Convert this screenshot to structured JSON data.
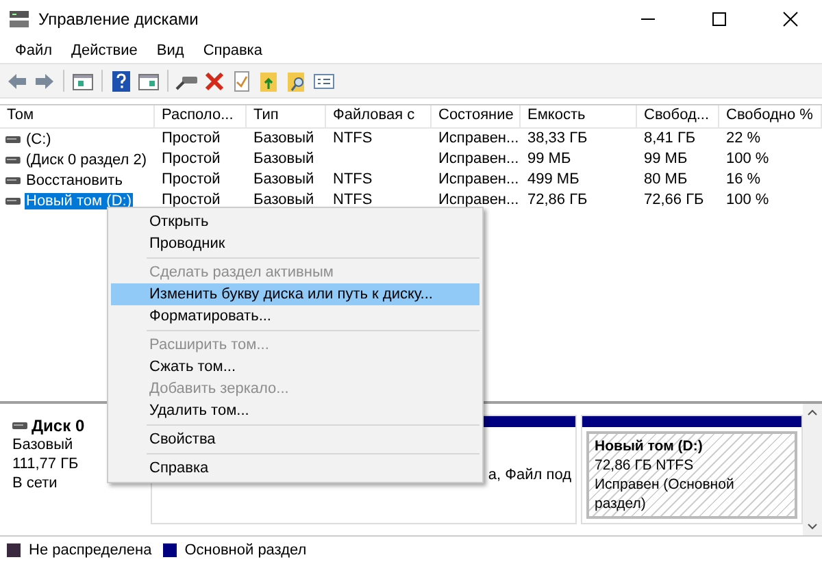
{
  "window": {
    "title": "Управление дисками"
  },
  "menu_bar": [
    "Файл",
    "Действие",
    "Вид",
    "Справка"
  ],
  "table": {
    "columns": [
      "Том",
      "Располо...",
      "Тип",
      "Файловая с",
      "Состояние",
      "Емкость",
      "Свобод...",
      "Свободно %"
    ],
    "rows": [
      {
        "selected": false,
        "cells": [
          "(C:)",
          "Простой",
          "Базовый",
          "NTFS",
          "Исправен...",
          "38,33 ГБ",
          "8,41 ГБ",
          "22 %"
        ]
      },
      {
        "selected": false,
        "cells": [
          "(Диск 0 раздел 2)",
          "Простой",
          "Базовый",
          "",
          "Исправен...",
          "99 МБ",
          "99 МБ",
          "100 %"
        ]
      },
      {
        "selected": false,
        "cells": [
          "Восстановить",
          "Простой",
          "Базовый",
          "NTFS",
          "Исправен...",
          "499 МБ",
          "80 МБ",
          "16 %"
        ]
      },
      {
        "selected": true,
        "cells": [
          "Новый том (D:)",
          "Простой",
          "Базовый",
          "NTFS",
          "Исправен...",
          "72,86 ГБ",
          "72,66 ГБ",
          "100 %"
        ]
      }
    ]
  },
  "context_menu": {
    "groups": [
      [
        {
          "label": "Открыть",
          "disabled": false,
          "selected": false
        },
        {
          "label": "Проводник",
          "disabled": false,
          "selected": false
        }
      ],
      [
        {
          "label": "Сделать раздел активным",
          "disabled": true,
          "selected": false
        },
        {
          "label": "Изменить букву диска или путь к диску...",
          "disabled": false,
          "selected": true
        },
        {
          "label": "Форматировать...",
          "disabled": false,
          "selected": false
        }
      ],
      [
        {
          "label": "Расширить том...",
          "disabled": true,
          "selected": false
        },
        {
          "label": "Сжать том...",
          "disabled": false,
          "selected": false
        },
        {
          "label": "Добавить зеркало...",
          "disabled": true,
          "selected": false
        },
        {
          "label": "Удалить том...",
          "disabled": false,
          "selected": false
        }
      ],
      [
        {
          "label": "Свойства",
          "disabled": false,
          "selected": false
        }
      ],
      [
        {
          "label": "Справка",
          "disabled": false,
          "selected": false
        }
      ]
    ]
  },
  "disk": {
    "name": "Диск 0",
    "type": "Базовый",
    "size": "111,77 ГБ",
    "status": "В сети",
    "partitions": [
      {
        "kind": "plain",
        "lines": [
          "а, Файл под"
        ]
      },
      {
        "kind": "hatched",
        "title": "Новый том  (D:)",
        "lines": [
          "72,86 ГБ NTFS",
          "Исправен (Основной раздел)"
        ]
      }
    ]
  },
  "legend": [
    {
      "label": "Не распределена",
      "color": "#3b2a3f"
    },
    {
      "label": "Основной раздел",
      "color": "#000080"
    }
  ]
}
